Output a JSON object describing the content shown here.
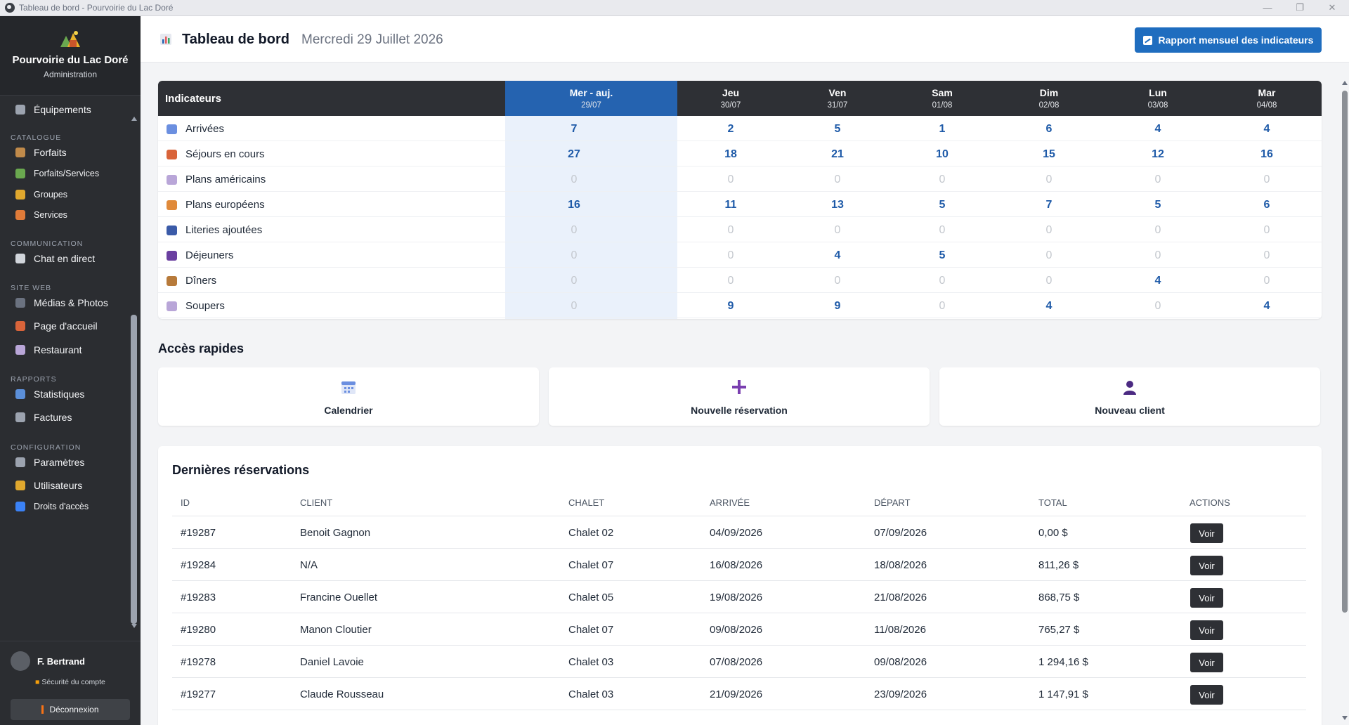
{
  "window": {
    "title": "Tableau de bord - Pourvoirie du Lac Doré"
  },
  "brand": {
    "name": "Pourvoirie du Lac Doré",
    "subtitle": "Administration"
  },
  "sidebar": {
    "top_items": [
      {
        "label": "Équipements",
        "icon": "wrench-icon"
      }
    ],
    "sections": [
      {
        "title": "CATALOGUE",
        "items": [
          {
            "label": "Forfaits",
            "icon": "package-icon"
          },
          {
            "label": "Forfaits/Services",
            "icon": "puzzle-icon"
          },
          {
            "label": "Groupes",
            "icon": "folder-icon"
          },
          {
            "label": "Services",
            "icon": "cloud-icon"
          }
        ]
      },
      {
        "title": "COMMUNICATION",
        "items": [
          {
            "label": "Chat en direct",
            "icon": "chat-bubble-icon"
          }
        ]
      },
      {
        "title": "SITE WEB",
        "items": [
          {
            "label": "Médias & Photos",
            "icon": "camera-icon"
          },
          {
            "label": "Page d'accueil",
            "icon": "house-icon"
          },
          {
            "label": "Restaurant",
            "icon": "plate-icon"
          }
        ]
      },
      {
        "title": "RAPPORTS",
        "items": [
          {
            "label": "Statistiques",
            "icon": "chart-icon"
          },
          {
            "label": "Factures",
            "icon": "document-icon"
          }
        ]
      },
      {
        "title": "CONFIGURATION",
        "items": [
          {
            "label": "Paramètres",
            "icon": "gear-icon"
          },
          {
            "label": "Utilisateurs",
            "icon": "users-icon"
          },
          {
            "label": "Droits d'accès",
            "icon": "shield-icon"
          }
        ]
      }
    ]
  },
  "user": {
    "name": "F. Bertrand",
    "security_label": "Sécurité du compte",
    "logout_label": "Déconnexion"
  },
  "header": {
    "title": "Tableau de bord",
    "date": "Mercredi 29 Juillet 2026",
    "report_button": "Rapport mensuel des indicateurs"
  },
  "indicators": {
    "header_label": "Indicateurs",
    "days": [
      {
        "name": "Mer - auj.",
        "date": "29/07"
      },
      {
        "name": "Jeu",
        "date": "30/07"
      },
      {
        "name": "Ven",
        "date": "31/07"
      },
      {
        "name": "Sam",
        "date": "01/08"
      },
      {
        "name": "Dim",
        "date": "02/08"
      },
      {
        "name": "Lun",
        "date": "03/08"
      },
      {
        "name": "Mar",
        "date": "04/08"
      }
    ],
    "rows": [
      {
        "label": "Arrivées",
        "icon": "calendar-icon",
        "values": [
          7,
          2,
          5,
          1,
          6,
          4,
          4
        ]
      },
      {
        "label": "Séjours en cours",
        "icon": "house-icon",
        "values": [
          27,
          18,
          21,
          10,
          15,
          12,
          16
        ]
      },
      {
        "label": "Plans américains",
        "icon": "plate-icon",
        "values": [
          0,
          0,
          0,
          0,
          0,
          0,
          0
        ]
      },
      {
        "label": "Plans européens",
        "icon": "croissant-icon",
        "values": [
          16,
          11,
          13,
          5,
          7,
          5,
          6
        ]
      },
      {
        "label": "Literies ajoutées",
        "icon": "bed-icon",
        "values": [
          0,
          0,
          0,
          0,
          0,
          0,
          0
        ]
      },
      {
        "label": "Déjeuners",
        "icon": "magnifier-icon",
        "values": [
          0,
          0,
          4,
          5,
          0,
          0,
          0
        ]
      },
      {
        "label": "Dîners",
        "icon": "burger-icon",
        "values": [
          0,
          0,
          0,
          0,
          0,
          4,
          0
        ]
      },
      {
        "label": "Soupers",
        "icon": "plate-icon",
        "values": [
          0,
          9,
          9,
          0,
          4,
          0,
          4
        ]
      }
    ]
  },
  "quick_access": {
    "title": "Accès rapides",
    "cards": [
      {
        "label": "Calendrier",
        "icon": "calendar-icon"
      },
      {
        "label": "Nouvelle réservation",
        "icon": "plus-icon"
      },
      {
        "label": "Nouveau client",
        "icon": "user-icon"
      }
    ]
  },
  "reservations": {
    "title": "Dernières réservations",
    "columns": [
      "ID",
      "CLIENT",
      "CHALET",
      "ARRIVÉE",
      "DÉPART",
      "TOTAL",
      "ACTIONS"
    ],
    "action_label": "Voir",
    "rows": [
      {
        "id": "#19287",
        "client": "Benoit Gagnon",
        "chalet": "Chalet 02",
        "arrival": "04/09/2026",
        "departure": "07/09/2026",
        "total": "0,00 $"
      },
      {
        "id": "#19284",
        "client": "N/A",
        "chalet": "Chalet 07",
        "arrival": "16/08/2026",
        "departure": "18/08/2026",
        "total": "811,26 $"
      },
      {
        "id": "#19283",
        "client": "Francine Ouellet",
        "chalet": "Chalet 05",
        "arrival": "19/08/2026",
        "departure": "21/08/2026",
        "total": "868,75 $"
      },
      {
        "id": "#19280",
        "client": "Manon Cloutier",
        "chalet": "Chalet 07",
        "arrival": "09/08/2026",
        "departure": "11/08/2026",
        "total": "765,27 $"
      },
      {
        "id": "#19278",
        "client": "Daniel Lavoie",
        "chalet": "Chalet 03",
        "arrival": "07/08/2026",
        "departure": "09/08/2026",
        "total": "1 294,16 $"
      },
      {
        "id": "#19277",
        "client": "Claude Rousseau",
        "chalet": "Chalet 03",
        "arrival": "21/09/2026",
        "departure": "23/09/2026",
        "total": "1 147,91 $"
      }
    ]
  },
  "colors": {
    "accent": "#1f6dbf",
    "sidebar_bg": "#2b2d31",
    "table_header_bg": "#2e3035",
    "today_header_bg": "#2563b0",
    "today_col_bg": "#eaf1fb",
    "value_positive": "#1e5aa8",
    "value_zero": "#c4c8ce"
  }
}
